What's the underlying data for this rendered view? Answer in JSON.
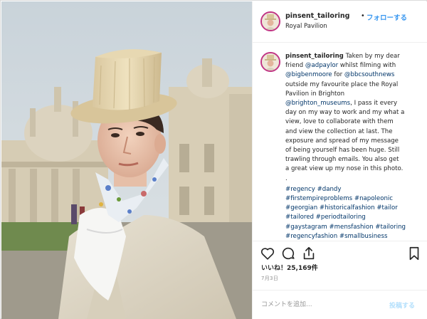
{
  "post": {
    "image_description_hidden": "",
    "header": {
      "username": "pinsent_tailoring",
      "separator": "•",
      "follow_label": "フォローする",
      "location": "Royal Pavilion"
    },
    "caption": {
      "username": "pinsent_tailoring",
      "lines": [
        "Taken by my dear",
        "whilst filming with",
        "for",
        "outside my favourite place the Royal",
        "Pavilion in Brighton",
        ", I pass it every",
        "day on my way to work and my what a",
        "view, love to collaborate with them",
        "and view the collection at last. The",
        "exposure and spread of my message",
        "of being yourself has been huge. Still",
        "trawling through emails. You also get",
        "a great view up my nose in this photo.",
        "."
      ],
      "mentions": {
        "adpaylor": "@adpaylor",
        "bigbenmoore": "@bigbenmoore",
        "bbcsouthnews": "@bbcsouthnews",
        "brighton_museums": "@brighton_museums"
      },
      "friend_prefix": "friend",
      "hashtag_lines": [
        "#regency #dandy",
        "#firstempireproblems #napoleonic",
        "#georgian #historicalfashion #tailor",
        "#tailored #periodtailoring",
        "#gaystagram #mensfashion #tailoring",
        "#regencyfashion #smallbusiness"
      ]
    },
    "actions": {
      "like_icon": "heart-outline-icon",
      "comment_icon": "comment-bubble-icon",
      "share_icon": "share-arrow-icon",
      "save_icon": "bookmark-outline-icon",
      "likes_text": "いいね！25,169件",
      "date_text": "7月3日"
    },
    "comment": {
      "placeholder": "コメントを追加...",
      "post_label": "投稿する"
    }
  },
  "colors": {
    "link": "#003569",
    "follow": "#3897f0",
    "post_disabled": "#b2dffc",
    "avatar_ring": "#c13584"
  }
}
